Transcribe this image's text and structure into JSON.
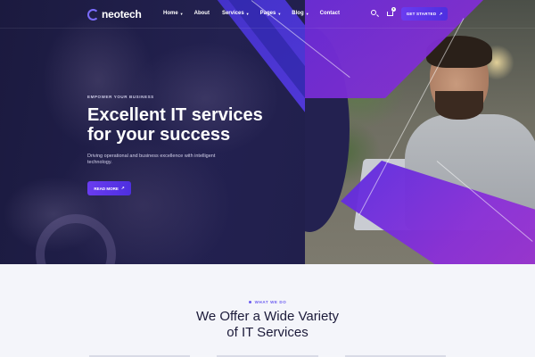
{
  "brand": {
    "name": "neotech",
    "accent": "#6a3cf0",
    "dark": "#232150"
  },
  "nav": {
    "items": [
      {
        "label": "Home",
        "has_dropdown": true
      },
      {
        "label": "About",
        "has_dropdown": false
      },
      {
        "label": "Services",
        "has_dropdown": true
      },
      {
        "label": "Pages",
        "has_dropdown": true
      },
      {
        "label": "Blog",
        "has_dropdown": true
      },
      {
        "label": "Contact",
        "has_dropdown": false
      }
    ],
    "search_icon": "search-icon",
    "cart_icon": "cart-icon",
    "cart_count": "0",
    "cta_label": "GET STARTED",
    "cta_icon": "arrow-up-right-icon"
  },
  "hero": {
    "eyebrow": "EMPOWER YOUR BUSINESS",
    "title_line1": "Excellent IT services",
    "title_line2": "for your success",
    "description": "Driving operational and business excellence with intelligent technology.",
    "button_label": "READ MORE",
    "button_icon": "arrow-up-right-icon"
  },
  "section": {
    "eyebrow": "WHAT WE DO",
    "title_line1": "We Offer a Wide Variety",
    "title_line2": "of IT Services"
  }
}
